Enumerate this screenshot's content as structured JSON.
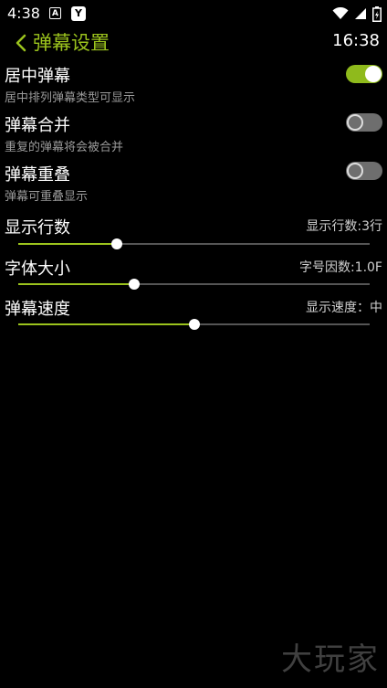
{
  "status": {
    "time": "4:38",
    "notif_a": "A",
    "notif_y": "Y"
  },
  "header": {
    "title": "弹幕设置",
    "clock": "16:38"
  },
  "toggles": [
    {
      "title": "居中弹幕",
      "desc": "居中排列弹幕类型可显示",
      "on": true
    },
    {
      "title": "弹幕合并",
      "desc": "重复的弹幕将会被合并",
      "on": false
    },
    {
      "title": "弹幕重叠",
      "desc": "弹幕可重叠显示",
      "on": false
    }
  ],
  "sliders": [
    {
      "title": "显示行数",
      "value_label": "显示行数:3行",
      "fraction": 0.28
    },
    {
      "title": "字体大小",
      "value_label": "字号因数:1.0F",
      "fraction": 0.33
    },
    {
      "title": "弹幕速度",
      "value_label": "显示速度：中",
      "fraction": 0.5
    }
  ],
  "watermark": "大玩家",
  "colors": {
    "accent": "#9bc31d",
    "switch_off": "#6e6e6e",
    "track": "#555555"
  }
}
